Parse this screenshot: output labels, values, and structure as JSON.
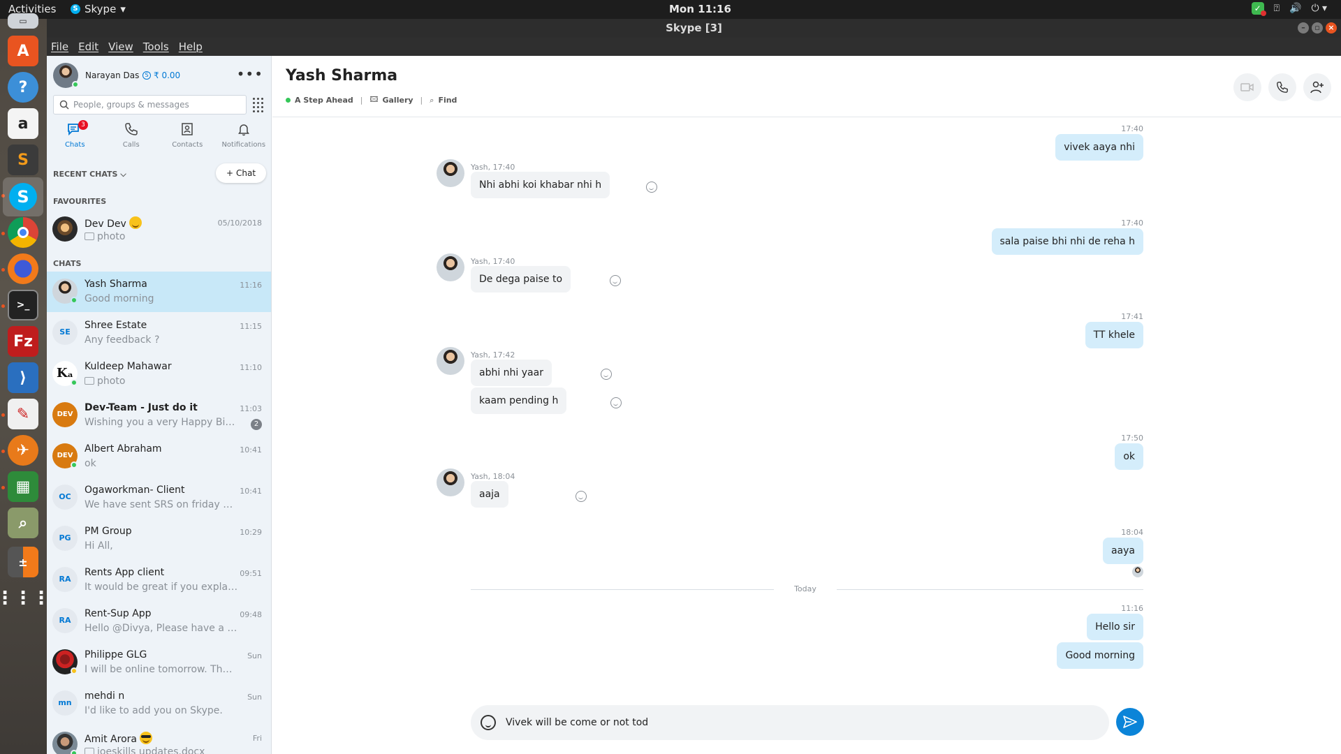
{
  "topbar": {
    "activities": "Activities",
    "app_name": "Skype",
    "clock": "Mon 11:16"
  },
  "window": {
    "title": "Skype [3]"
  },
  "menu": {
    "file": "File",
    "edit": "Edit",
    "view": "View",
    "tools": "Tools",
    "help": "Help"
  },
  "profile": {
    "name": "Narayan Das",
    "credit": "₹ 0.00"
  },
  "search": {
    "placeholder": "People, groups & messages"
  },
  "nav": {
    "chats": "Chats",
    "chats_badge": "3",
    "calls": "Calls",
    "contacts": "Contacts",
    "notifications": "Notifications"
  },
  "sections": {
    "recent": "RECENT CHATS",
    "new_chat": "Chat",
    "favourites": "FAVOURITES",
    "chats": "CHATS"
  },
  "favourites": [
    {
      "name": "Dev Dev",
      "message": "photo",
      "time": "05/10/2018"
    }
  ],
  "chats": [
    {
      "name": "Yash Sharma",
      "message": "Good morning",
      "time": "11:16"
    },
    {
      "name": "Shree Estate",
      "initials": "SE",
      "message": "Any feedback ?",
      "time": "11:15"
    },
    {
      "name": "Kuldeep Mahawar",
      "message": "photo",
      "time": "11:10"
    },
    {
      "name": "Dev-Team - Just do it",
      "message": "Wishing you a very Happy Birth...",
      "time": "11:03",
      "unread": "2"
    },
    {
      "name": "Albert Abraham",
      "message": "ok",
      "time": "10:41"
    },
    {
      "name": "Ogaworkman- Client",
      "initials": "OC",
      "message": "We have sent SRS on friday via e...",
      "time": "10:41"
    },
    {
      "name": "PM Group",
      "initials": "PG",
      "message": "Hi All,",
      "time": "10:29"
    },
    {
      "name": "Rents App client",
      "initials": "RA",
      "message": "It would be great if you explain t...",
      "time": "09:51"
    },
    {
      "name": "Rent-Sup App",
      "initials": "RA",
      "message": "Hello @Divya, Please have a loo...",
      "time": "09:48"
    },
    {
      "name": "Philippe GLG",
      "message": "I will be online tomorrow. Thanks",
      "time": "Sun"
    },
    {
      "name": "mehdi n",
      "initials": "mn",
      "message": "I'd like to add you on Skype.",
      "time": "Sun"
    },
    {
      "name": "Amit Arora",
      "message": "joeskills updates.docx",
      "time": "Fri"
    }
  ],
  "conversation": {
    "name": "Yash Sharma",
    "mood": "A Step Ahead",
    "gallery": "Gallery",
    "find": "Find",
    "divider": "Today",
    "messages": [
      {
        "time": "17:40",
        "text": "vivek aaya nhi"
      },
      {
        "meta": "Yash, 17:40",
        "text": "Nhi abhi koi khabar nhi h"
      },
      {
        "time": "17:40",
        "text": "sala paise bhi nhi de reha h"
      },
      {
        "meta": "Yash, 17:40",
        "text": "De dega paise to"
      },
      {
        "time": "17:41",
        "text": "TT khele"
      },
      {
        "meta": "Yash, 17:42",
        "text": "abhi nhi yaar"
      },
      {
        "text": "kaam pending h"
      },
      {
        "time": "17:50",
        "text": "ok"
      },
      {
        "meta": "Yash, 18:04",
        "text": "aaja"
      },
      {
        "time": "18:04",
        "text": "aaya"
      },
      {
        "time": "11:16",
        "text": "Hello sir"
      },
      {
        "text": "Good morning"
      }
    ],
    "draft": "Vivek will be come or not tod"
  }
}
